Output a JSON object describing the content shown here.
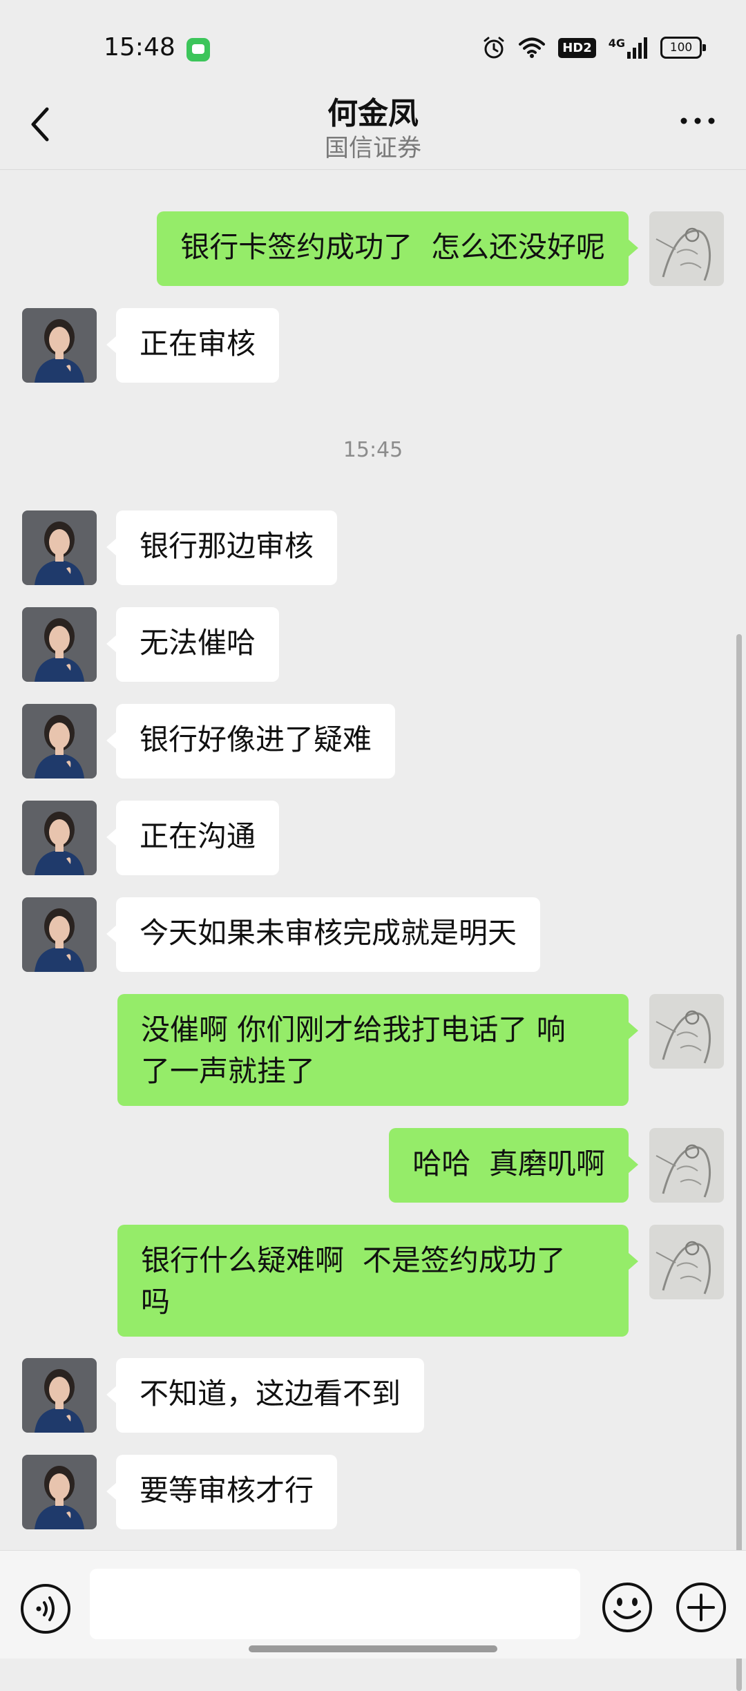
{
  "status_bar": {
    "time": "15:48",
    "icons": [
      "message-notification-icon",
      "alarm-icon",
      "wifi-icon",
      "hd-icon",
      "signal-4g-icon",
      "battery-icon"
    ],
    "hd_label": "HD2",
    "network_label": "4G",
    "battery_level": "100"
  },
  "header": {
    "title": "何金凤",
    "subtitle": "国信证券",
    "back_icon": "chevron-left-icon",
    "more_icon": "more-dots-icon"
  },
  "messages": [
    {
      "side": "right",
      "text": "银行卡签约成功了  怎么还没好呢"
    },
    {
      "side": "left",
      "text": "正在审核"
    },
    {
      "type": "time",
      "text": "15:45"
    },
    {
      "side": "left",
      "text": "银行那边审核"
    },
    {
      "side": "left",
      "text": "无法催哈"
    },
    {
      "side": "left",
      "text": "银行好像进了疑难"
    },
    {
      "side": "left",
      "text": "正在沟通"
    },
    {
      "side": "left",
      "text": "今天如果未审核完成就是明天"
    },
    {
      "side": "right",
      "text": "没催啊 你们刚才给我打电话了 响\n了一声就挂了"
    },
    {
      "side": "right",
      "text": "哈哈  真磨叽啊"
    },
    {
      "side": "right",
      "text": "银行什么疑难啊  不是签约成功了\n吗"
    },
    {
      "side": "left",
      "text": "不知道，这边看不到"
    },
    {
      "side": "left",
      "text": "要等审核才行"
    }
  ],
  "input_bar": {
    "voice_icon": "voice-icon",
    "emoji_icon": "emoji-icon",
    "plus_icon": "plus-icon",
    "placeholder": ""
  },
  "colors": {
    "background": "#ededed",
    "sent_bubble": "#95ec69",
    "received_bubble": "#ffffff",
    "timestamp": "#8c8c8c"
  }
}
